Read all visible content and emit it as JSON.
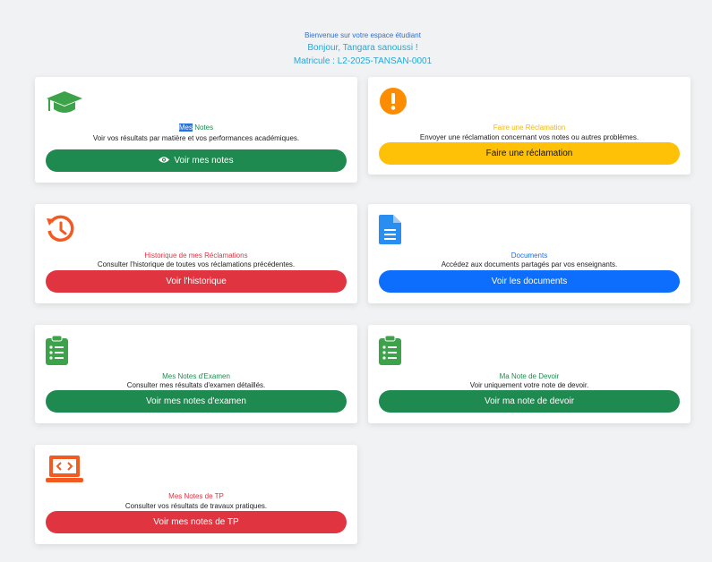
{
  "header": {
    "welcome": "Bienvenue sur votre espace étudiant",
    "greeting": "Bonjour, Tangara sanoussi !",
    "matricule": "Matricule : L2-2025-TANSAN-0001"
  },
  "cards": [
    {
      "title_highlight": "Mes",
      "title_rest": " Notes",
      "description": "Voir vos résultats par matière et vos performances académiques.",
      "button": "Voir mes notes",
      "icon": "graduation-cap-icon",
      "color": "#1e8a4f"
    },
    {
      "title": "Faire une Réclamation",
      "description": "Envoyer une réclamation concernant vos notes ou autres problèmes.",
      "button": "Faire une réclamation",
      "icon": "exclamation-circle-icon",
      "color": "#ffc107"
    },
    {
      "title": "Historique de mes Réclamations",
      "description": "Consulter l'historique de toutes vos réclamations précédentes.",
      "button": "Voir l'historique",
      "icon": "history-icon",
      "color": "#e13441"
    },
    {
      "title": "Documents",
      "description": "Accédez aux documents partagés par vos enseignants.",
      "button": "Voir les documents",
      "icon": "document-icon",
      "color": "#0d6efd"
    },
    {
      "title": "Mes Notes d'Examen",
      "description": "Consulter mes résultats d'examen détaillés.",
      "button": "Voir mes notes d'examen",
      "icon": "clipboard-list-icon",
      "color": "#1e8a4f"
    },
    {
      "title": "Ma Note de Devoir",
      "description": "Voir uniquement votre note de devoir.",
      "button": "Voir ma note de devoir",
      "icon": "clipboard-list-icon",
      "color": "#1e8a4f"
    },
    {
      "title": "Mes Notes de TP",
      "description": "Consulter vos résultats de travaux pratiques.",
      "button": "Voir mes notes de TP",
      "icon": "laptop-code-icon",
      "color": "#e13441"
    }
  ]
}
